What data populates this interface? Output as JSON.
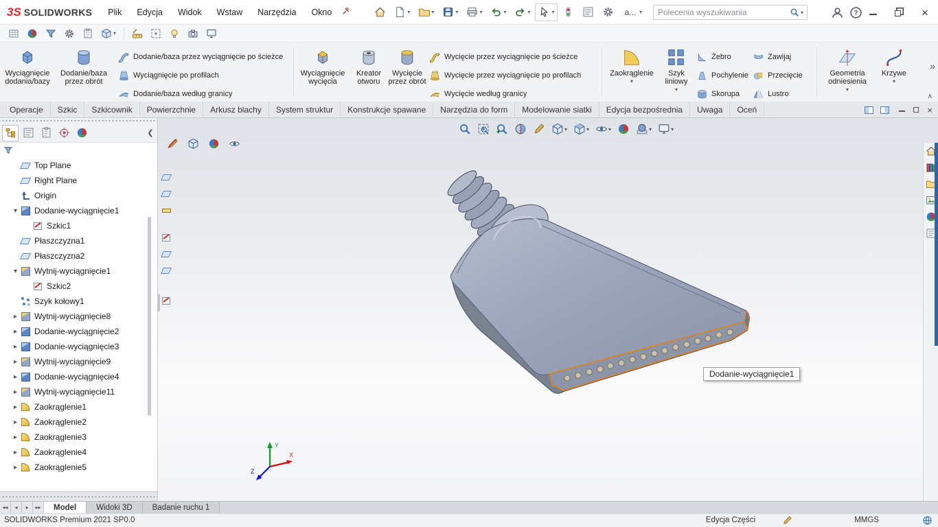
{
  "titlebar": {
    "brand_mark": "3S",
    "brand_name": "SOLIDWORKS",
    "menus": [
      "Plik",
      "Edycja",
      "Widok",
      "Wstaw",
      "Narzędzia",
      "Okno"
    ],
    "toolbar_icons": [
      "home",
      "new-document",
      "open",
      "save",
      "print",
      "undo",
      "redo",
      "select-cursor",
      "rebuild-traffic-light",
      "document-properties",
      "options-gear",
      "appearance"
    ],
    "appearance_text": "a...",
    "search_placeholder": "Polecenia wyszukiwania",
    "window_controls": [
      "minimize",
      "restore",
      "close"
    ]
  },
  "quickbar_icons": [
    "sketch-grid",
    "render-sphere",
    "selection-filter",
    "system-options",
    "design-binder",
    "part-cube",
    "measure-ruler",
    "section-frame",
    "lights-bulb",
    "camera",
    "display-monitor"
  ],
  "ribbon": {
    "big1": [
      "Wyciągnięcie dodania/bazy",
      "Dodanie/baza przez obrót"
    ],
    "stack1": [
      "Dodanie/baza przez wyciągnięcie po ścieżce",
      "Wyciągnięcie po profilach",
      "Dodanie/baza według granicy"
    ],
    "big2": [
      "Wyciągnięcie wycięcia",
      "Kreator otworu",
      "Wycięcie przez obrót"
    ],
    "stack2": [
      "Wycięcie przez wyciągnięcie po ścieżce",
      "Wycięcie przez wyciągnięcie po profilach",
      "Wycięcie według granicy"
    ],
    "big3": [
      "Zaokrąglenie",
      "Szyk liniowy"
    ],
    "stack3": [
      "Żebro",
      "Pochylenie",
      "Skorupa"
    ],
    "stack4": [
      "Zawijaj",
      "Przecięcie",
      "Lustro"
    ],
    "big4": [
      "Geometria odniesienia",
      "Krzywe"
    ],
    "overflow": "»",
    "collapse": "∧"
  },
  "command_tabs": [
    "Operacje",
    "Szkic",
    "Szkicownik",
    "Powierzchnie",
    "Arkusz blachy",
    "System struktur",
    "Konstrukcje spawane",
    "Narzędzia do form",
    "Modelowanie siatki",
    "Edycja bezpośrednia",
    "Uwaga",
    "Oceń"
  ],
  "active_command_tab": "Operacje",
  "panel_tab_icons": [
    "feature-manager-tree",
    "property-manager",
    "configuration-manager",
    "dimxpert-manager",
    "display-manager"
  ],
  "feature_tree": [
    {
      "label": "Top Plane",
      "icon": "plane",
      "ind": "d1",
      "expand": ""
    },
    {
      "label": "Right Plane",
      "icon": "plane",
      "ind": "d1",
      "expand": ""
    },
    {
      "label": "Origin",
      "icon": "origin",
      "ind": "d1",
      "expand": ""
    },
    {
      "label": "Dodanie-wyciągnięcie1",
      "icon": "boss",
      "ind": "d1",
      "expand": "▾"
    },
    {
      "label": "Szkic1",
      "icon": "sketch",
      "ind": "d2",
      "expand": ""
    },
    {
      "label": "Płaszczyzna1",
      "icon": "plane",
      "ind": "d1",
      "expand": ""
    },
    {
      "label": "Płaszczyzna2",
      "icon": "plane",
      "ind": "d1",
      "expand": ""
    },
    {
      "label": "Wytnij-wyciągnięcie1",
      "icon": "cut",
      "ind": "d1",
      "expand": "▾"
    },
    {
      "label": "Szkic2",
      "icon": "sketch",
      "ind": "d2",
      "expand": ""
    },
    {
      "label": "Szyk kołowy1",
      "icon": "cpattern",
      "ind": "d1",
      "expand": ""
    },
    {
      "label": "Wytnij-wyciągnięcie8",
      "icon": "cut",
      "ind": "d1",
      "expand": "▸"
    },
    {
      "label": "Dodanie-wyciągnięcie2",
      "icon": "boss",
      "ind": "d1",
      "expand": "▸"
    },
    {
      "label": "Dodanie-wyciągnięcie3",
      "icon": "boss",
      "ind": "d1",
      "expand": "▸"
    },
    {
      "label": "Wytnij-wyciągnięcie9",
      "icon": "cut",
      "ind": "d1",
      "expand": "▸"
    },
    {
      "label": "Dodanie-wyciągnięcie4",
      "icon": "boss",
      "ind": "d1",
      "expand": "▸"
    },
    {
      "label": "Wytnij-wyciągnięcie11",
      "icon": "cut",
      "ind": "d1",
      "expand": "▸"
    },
    {
      "label": "Zaokrąglenie1",
      "icon": "fillet",
      "ind": "d1",
      "expand": "▸"
    },
    {
      "label": "Zaokrąglenie2",
      "icon": "fillet",
      "ind": "d1",
      "expand": "▸"
    },
    {
      "label": "Zaokrąglenie3",
      "icon": "fillet",
      "ind": "d1",
      "expand": "▸"
    },
    {
      "label": "Zaokrąglenie4",
      "icon": "fillet",
      "ind": "d1",
      "expand": "▸"
    },
    {
      "label": "Zaokrąglenie5",
      "icon": "fillet",
      "ind": "d1",
      "expand": "▸"
    }
  ],
  "viewport": {
    "tooltip": "Dodanie-wyciągnięcie1",
    "headsup_icons": [
      "zoom-fit",
      "zoom-area",
      "previous-view",
      "section-view",
      "annotations",
      "view-orientation",
      "display-style",
      "hide-show-items",
      "edit-appearance",
      "apply-scene",
      "view-settings"
    ],
    "floating_icons": [
      "sketch-toggle",
      "isometric-cube",
      "appearance-ball",
      "visibility-eye"
    ],
    "taskpane_icons": [
      "home",
      "design-library",
      "file-explorer",
      "view-palette",
      "appearances",
      "custom-properties"
    ],
    "triad": {
      "x": "X",
      "y": "Y",
      "z": "Z"
    },
    "model_color": "#9aa3b8",
    "selection_color": "#e87f12"
  },
  "bottom_tabs": [
    "Model",
    "Widoki 3D",
    "Badanie ruchu 1"
  ],
  "active_bottom_tab": "Model",
  "statusbar": {
    "left": "SOLIDWORKS Premium 2021 SP0.0",
    "mode": "Edycja Części",
    "units": "MMGS"
  }
}
